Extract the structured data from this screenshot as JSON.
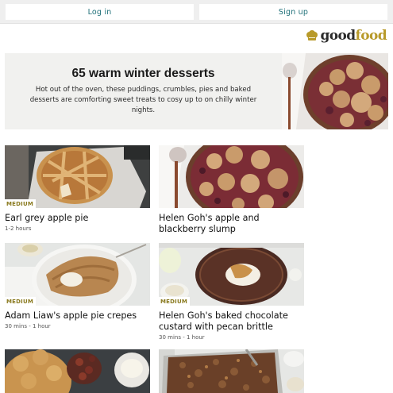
{
  "auth": {
    "login_label": "Log in",
    "signup_label": "Sign up"
  },
  "brand": {
    "logo_word_1": "good",
    "logo_word_2": "food",
    "accent_color": "#b89a2a"
  },
  "hero": {
    "title": "65 warm winter desserts",
    "description": "Hot out of the oven, these puddings, crumbles, pies and baked desserts are comforting sweet treats to cosy up to on chilly winter nights."
  },
  "recipes": [
    {
      "badge": "MEDIUM",
      "title": "Earl grey apple pie",
      "meta": "1-2 hours"
    },
    {
      "badge": "",
      "title": "Helen Goh's apple and blackberry slump",
      "meta": ""
    },
    {
      "badge": "MEDIUM",
      "title": "Adam Liaw's apple pie crepes",
      "meta": "30 mins - 1 hour"
    },
    {
      "badge": "MEDIUM",
      "title": "Helen Goh's baked chocolate custard with pecan brittle",
      "meta": "30 mins - 1 hour"
    },
    {
      "badge": "",
      "title": "",
      "meta": ""
    },
    {
      "badge": "",
      "title": "",
      "meta": ""
    }
  ]
}
